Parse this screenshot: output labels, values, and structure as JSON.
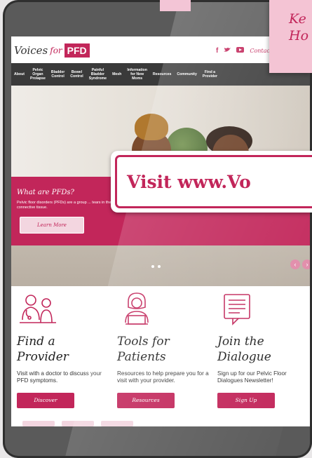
{
  "sticky_note": {
    "text": "Ke\nHo"
  },
  "header": {
    "logo_script": "Voices",
    "logo_for": "for",
    "logo_pfd": "PFD",
    "contact": "Contact"
  },
  "nav": {
    "items": [
      "About",
      "Pelvic\nOrgan\nProlapse",
      "Bladder\nControl",
      "Bowel\nControl",
      "Painful\nBladder\nSyndrome",
      "Mesh",
      "Information\nfor New\nMoms",
      "Resources",
      "Community",
      "Find a\nProvider"
    ]
  },
  "hero": {
    "heading": "What are PFDs?",
    "body": "Pelvic floor disorders (PFDs) are a group ... tears in the connective tissue.",
    "cta": "Learn More",
    "slide_count": 2,
    "prev_icon": "‹",
    "next_icon": "›"
  },
  "banner": {
    "text": "Visit www.Vo"
  },
  "columns": [
    {
      "title": "Find a\nProvider",
      "desc": "Visit with a doctor to discuss your PFD symptoms.",
      "button": "Discover"
    },
    {
      "title": "Tools for\nPatients",
      "desc": "Resources to help prepare you for a visit with your provider.",
      "button": "Resources"
    },
    {
      "title": "Join the\nDialogue",
      "desc": "Sign up for our Pelvic Floor Dialogues Newsletter!",
      "button": "Sign Up"
    }
  ],
  "colors": {
    "brand": "#c2265a",
    "nav_bg": "#3a3a3a",
    "pink_light": "#f3d6e0"
  }
}
